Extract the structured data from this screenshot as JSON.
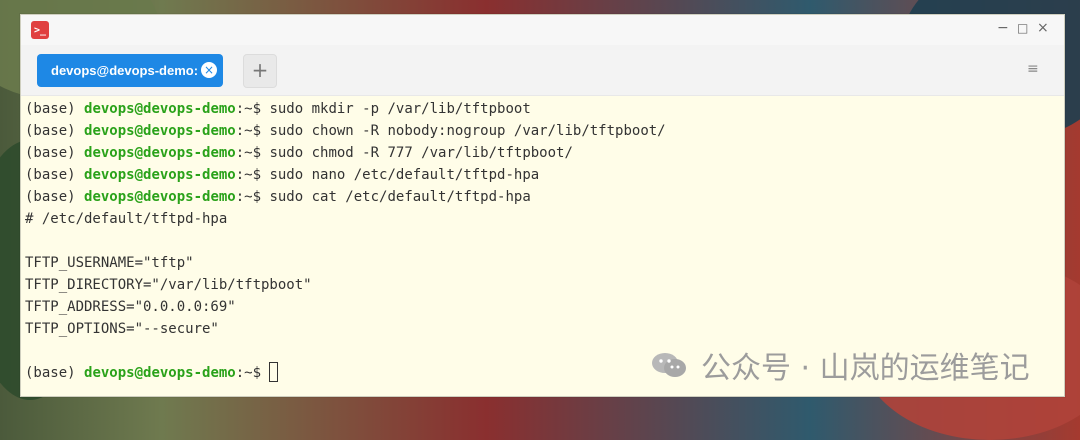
{
  "window": {
    "minimize_icon": "−",
    "maximize_icon": "□",
    "close_icon": "×"
  },
  "tabs": [
    {
      "label": "devops@devops-demo:",
      "close": "×",
      "active": true
    }
  ],
  "new_tab_label": "+",
  "menu_icon": "≡",
  "terminal": {
    "prefix": "(base) ",
    "user_host": "devops@devops-demo",
    "path_prompt": ":~$ ",
    "commands": [
      "sudo mkdir -p /var/lib/tftpboot",
      "sudo chown -R nobody:nogroup /var/lib/tftpboot/",
      "sudo chmod -R 777 /var/lib/tftpboot/",
      "sudo nano /etc/default/tftpd-hpa",
      "sudo cat /etc/default/tftpd-hpa"
    ],
    "output": [
      "# /etc/default/tftpd-hpa",
      "",
      "TFTP_USERNAME=\"tftp\"",
      "TFTP_DIRECTORY=\"/var/lib/tftpboot\"",
      "TFTP_ADDRESS=\"0.0.0.0:69\"",
      "TFTP_OPTIONS=\"--secure\"",
      ""
    ]
  },
  "watermark": {
    "text": "公众号 · 山岚的运维笔记",
    "icon": "wechat-icon"
  },
  "colors": {
    "tab_active": "#1e88e5",
    "terminal_bg": "#fffde8",
    "user_host": "#2aa21a"
  }
}
